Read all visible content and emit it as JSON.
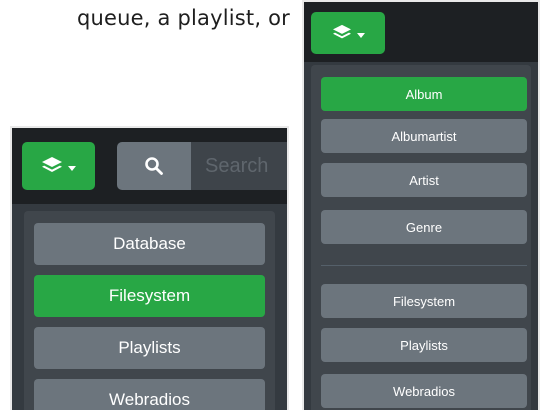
{
  "caption": "queue, a playlist, or",
  "left_panel": {
    "search_placeholder": "Search",
    "items": [
      {
        "label": "Database",
        "active": false
      },
      {
        "label": "Filesystem",
        "active": true
      },
      {
        "label": "Playlists",
        "active": false
      },
      {
        "label": "Webradios",
        "active": false
      }
    ]
  },
  "right_panel": {
    "group1": [
      {
        "label": "Album",
        "active": true
      },
      {
        "label": "Albumartist",
        "active": false
      },
      {
        "label": "Artist",
        "active": false
      },
      {
        "label": "Genre",
        "active": false
      }
    ],
    "group2": [
      {
        "label": "Filesystem",
        "active": false
      },
      {
        "label": "Playlists",
        "active": false
      },
      {
        "label": "Webradios",
        "active": false
      }
    ]
  },
  "icons": {
    "mode_button": "layers-icon",
    "dropdown": "caret-down-icon",
    "search": "search-icon"
  },
  "colors": {
    "accent_green": "#28a745",
    "item_gray": "#6c757d",
    "panel_bg": "#343a40",
    "topbar_bg": "#1d2023"
  }
}
